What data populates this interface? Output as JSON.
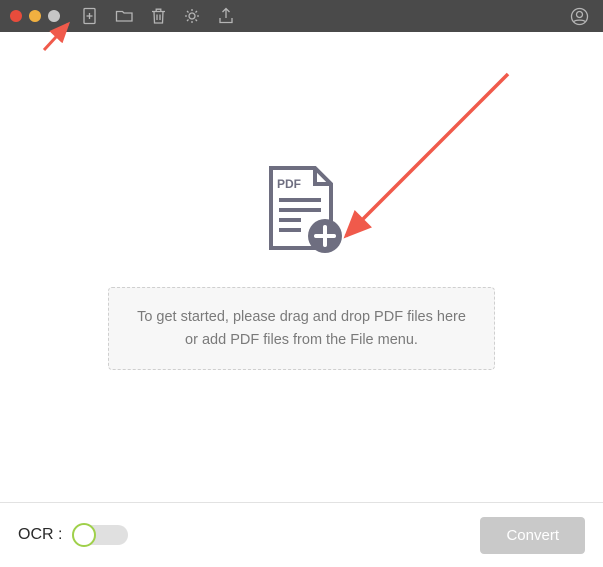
{
  "titlebar": {
    "icons": {
      "add": "add-page-icon",
      "folder": "folder-icon",
      "trash": "trash-icon",
      "gear": "gear-icon",
      "export": "export-icon",
      "account": "account-icon"
    }
  },
  "main": {
    "pdf_badge": "PDF",
    "drop_hint": "To get started, please drag and drop PDF files here or add PDF files from the File menu."
  },
  "footer": {
    "ocr_label": "OCR :",
    "ocr_on": false,
    "convert_label": "Convert",
    "convert_enabled": false
  },
  "annotations": {
    "arrow_color": "#f05a4b"
  }
}
